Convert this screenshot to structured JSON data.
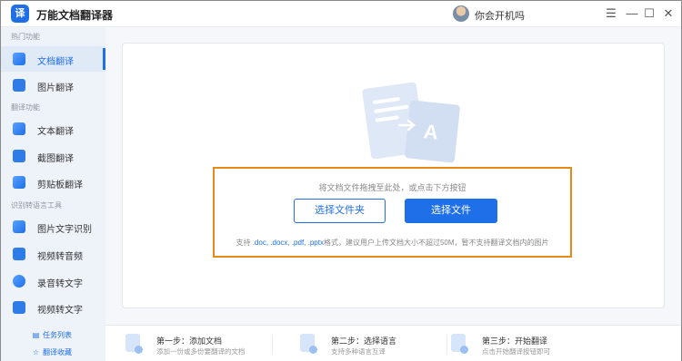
{
  "app": {
    "logo_glyph": "译",
    "title": "万能文档翻译器"
  },
  "user": {
    "name": "你会开机吗"
  },
  "window_controls": {
    "menu": "☰",
    "minimize": "—",
    "maximize": "☐",
    "close": "✕"
  },
  "sidebar": {
    "groups": [
      {
        "label": "热门功能"
      },
      {
        "label": "翻译功能"
      },
      {
        "label": "识别转语言工具"
      }
    ],
    "items": [
      {
        "label": "文档翻译",
        "icon": "document-icon",
        "active": true
      },
      {
        "label": "图片翻译",
        "icon": "image-icon"
      },
      {
        "label": "文本翻译",
        "icon": "text-icon"
      },
      {
        "label": "截图翻译",
        "icon": "screenshot-icon"
      },
      {
        "label": "剪贴板翻译",
        "icon": "clipboard-icon"
      },
      {
        "label": "图片文字识别",
        "icon": "ocr-icon"
      },
      {
        "label": "视频转音频",
        "icon": "video-icon"
      },
      {
        "label": "录音转文字",
        "icon": "record-icon"
      },
      {
        "label": "视频转文字",
        "icon": "video-text-icon"
      }
    ],
    "links": [
      {
        "label": "任务列表",
        "icon": "list-icon",
        "glyph": "▤"
      },
      {
        "label": "翻译收藏",
        "icon": "star-icon",
        "glyph": "☆"
      }
    ]
  },
  "dropzone": {
    "hint": "将文档文件拖拽至此处，或点击下方按钮",
    "select_folder": "选择文件夹",
    "select_file": "选择文件",
    "formats_prefix": "支持",
    "formats": ".doc, .docx, .pdf, .pptx",
    "formats_suffix": "格式，建议用户上传文档大小不超过50M，暂不支持翻译文档内的图片",
    "highlight_color": "#e58a19"
  },
  "steps": [
    {
      "title": "第一步：添加文档",
      "desc": "添加一份或多份要翻译的文档"
    },
    {
      "title": "第二步：选择语言",
      "desc": "支持多种语言互译"
    },
    {
      "title": "第三步：开始翻译",
      "desc": "点击开始翻译按钮即可"
    }
  ],
  "colors": {
    "accent": "#1e6fe8",
    "sidebar_bg": "#eef3fa",
    "main_bg": "#f5f7fa"
  }
}
